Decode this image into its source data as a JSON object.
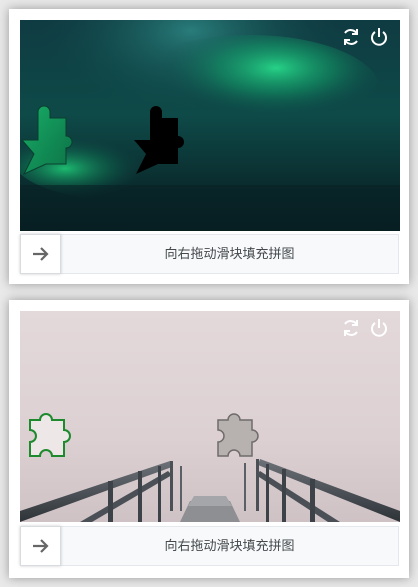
{
  "captchas": [
    {
      "hint": "向右拖动滑块填充拼图",
      "refresh_icon": "refresh-icon",
      "close_icon": "power-icon",
      "handle_icon": "arrow-right-icon",
      "background": "aurora"
    },
    {
      "hint": "向右拖动滑块填充拼图",
      "refresh_icon": "refresh-icon",
      "close_icon": "power-icon",
      "handle_icon": "arrow-right-icon",
      "background": "foggy-stairs"
    }
  ]
}
